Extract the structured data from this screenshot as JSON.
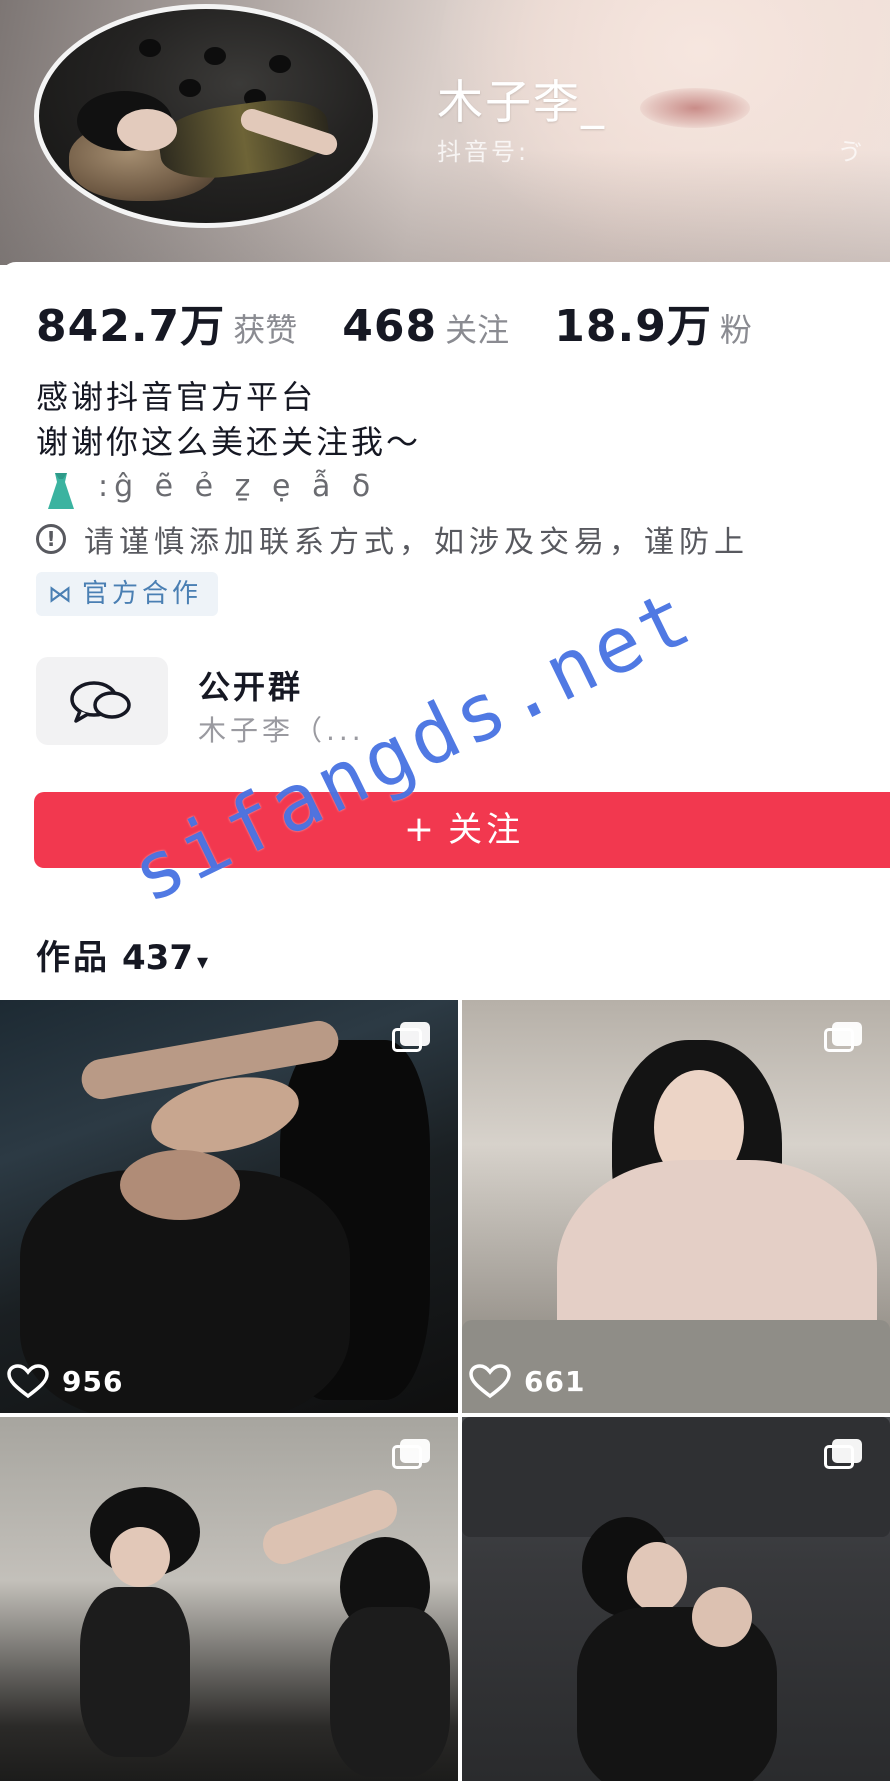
{
  "profile": {
    "name": "木子李_",
    "douyin_id_label": "抖音号:",
    "douyin_id_tail": "ゔ"
  },
  "stats": [
    {
      "value": "842.7万",
      "label": "获赞"
    },
    {
      "value": "468",
      "label": "关注"
    },
    {
      "value": "18.9万",
      "label": "粉"
    }
  ],
  "bio": {
    "line1": "感谢抖音官方平台",
    "line2": "谢谢你这么美还关注我～",
    "line3": ":ĝ ẽ ẻ ẕ ẹ ẫ ẟ",
    "dress_icon": "dress-icon",
    "dress_color": "#3bb3a0"
  },
  "warning": {
    "icon": "exclamation-circle-icon",
    "text": "请谨慎添加联系方式，如涉及交易，谨防上"
  },
  "official_tag": {
    "icon": "handshake-icon",
    "label": "官方合作"
  },
  "group": {
    "icon": "chat-bubbles-icon",
    "title": "公开群",
    "subtitle": "木子李（..."
  },
  "follow_button": {
    "plus": "+",
    "label": "关注",
    "color": "#f2384f"
  },
  "works": {
    "label": "作品",
    "count": "437",
    "caret": "▾"
  },
  "posts": [
    {
      "likes": "956",
      "multi_image": true
    },
    {
      "likes": "661",
      "multi_image": true
    },
    {
      "likes": "",
      "multi_image": true
    },
    {
      "likes": "",
      "multi_image": true
    }
  ],
  "watermark": {
    "text": "sifangds.net",
    "color": "#416ee1"
  }
}
